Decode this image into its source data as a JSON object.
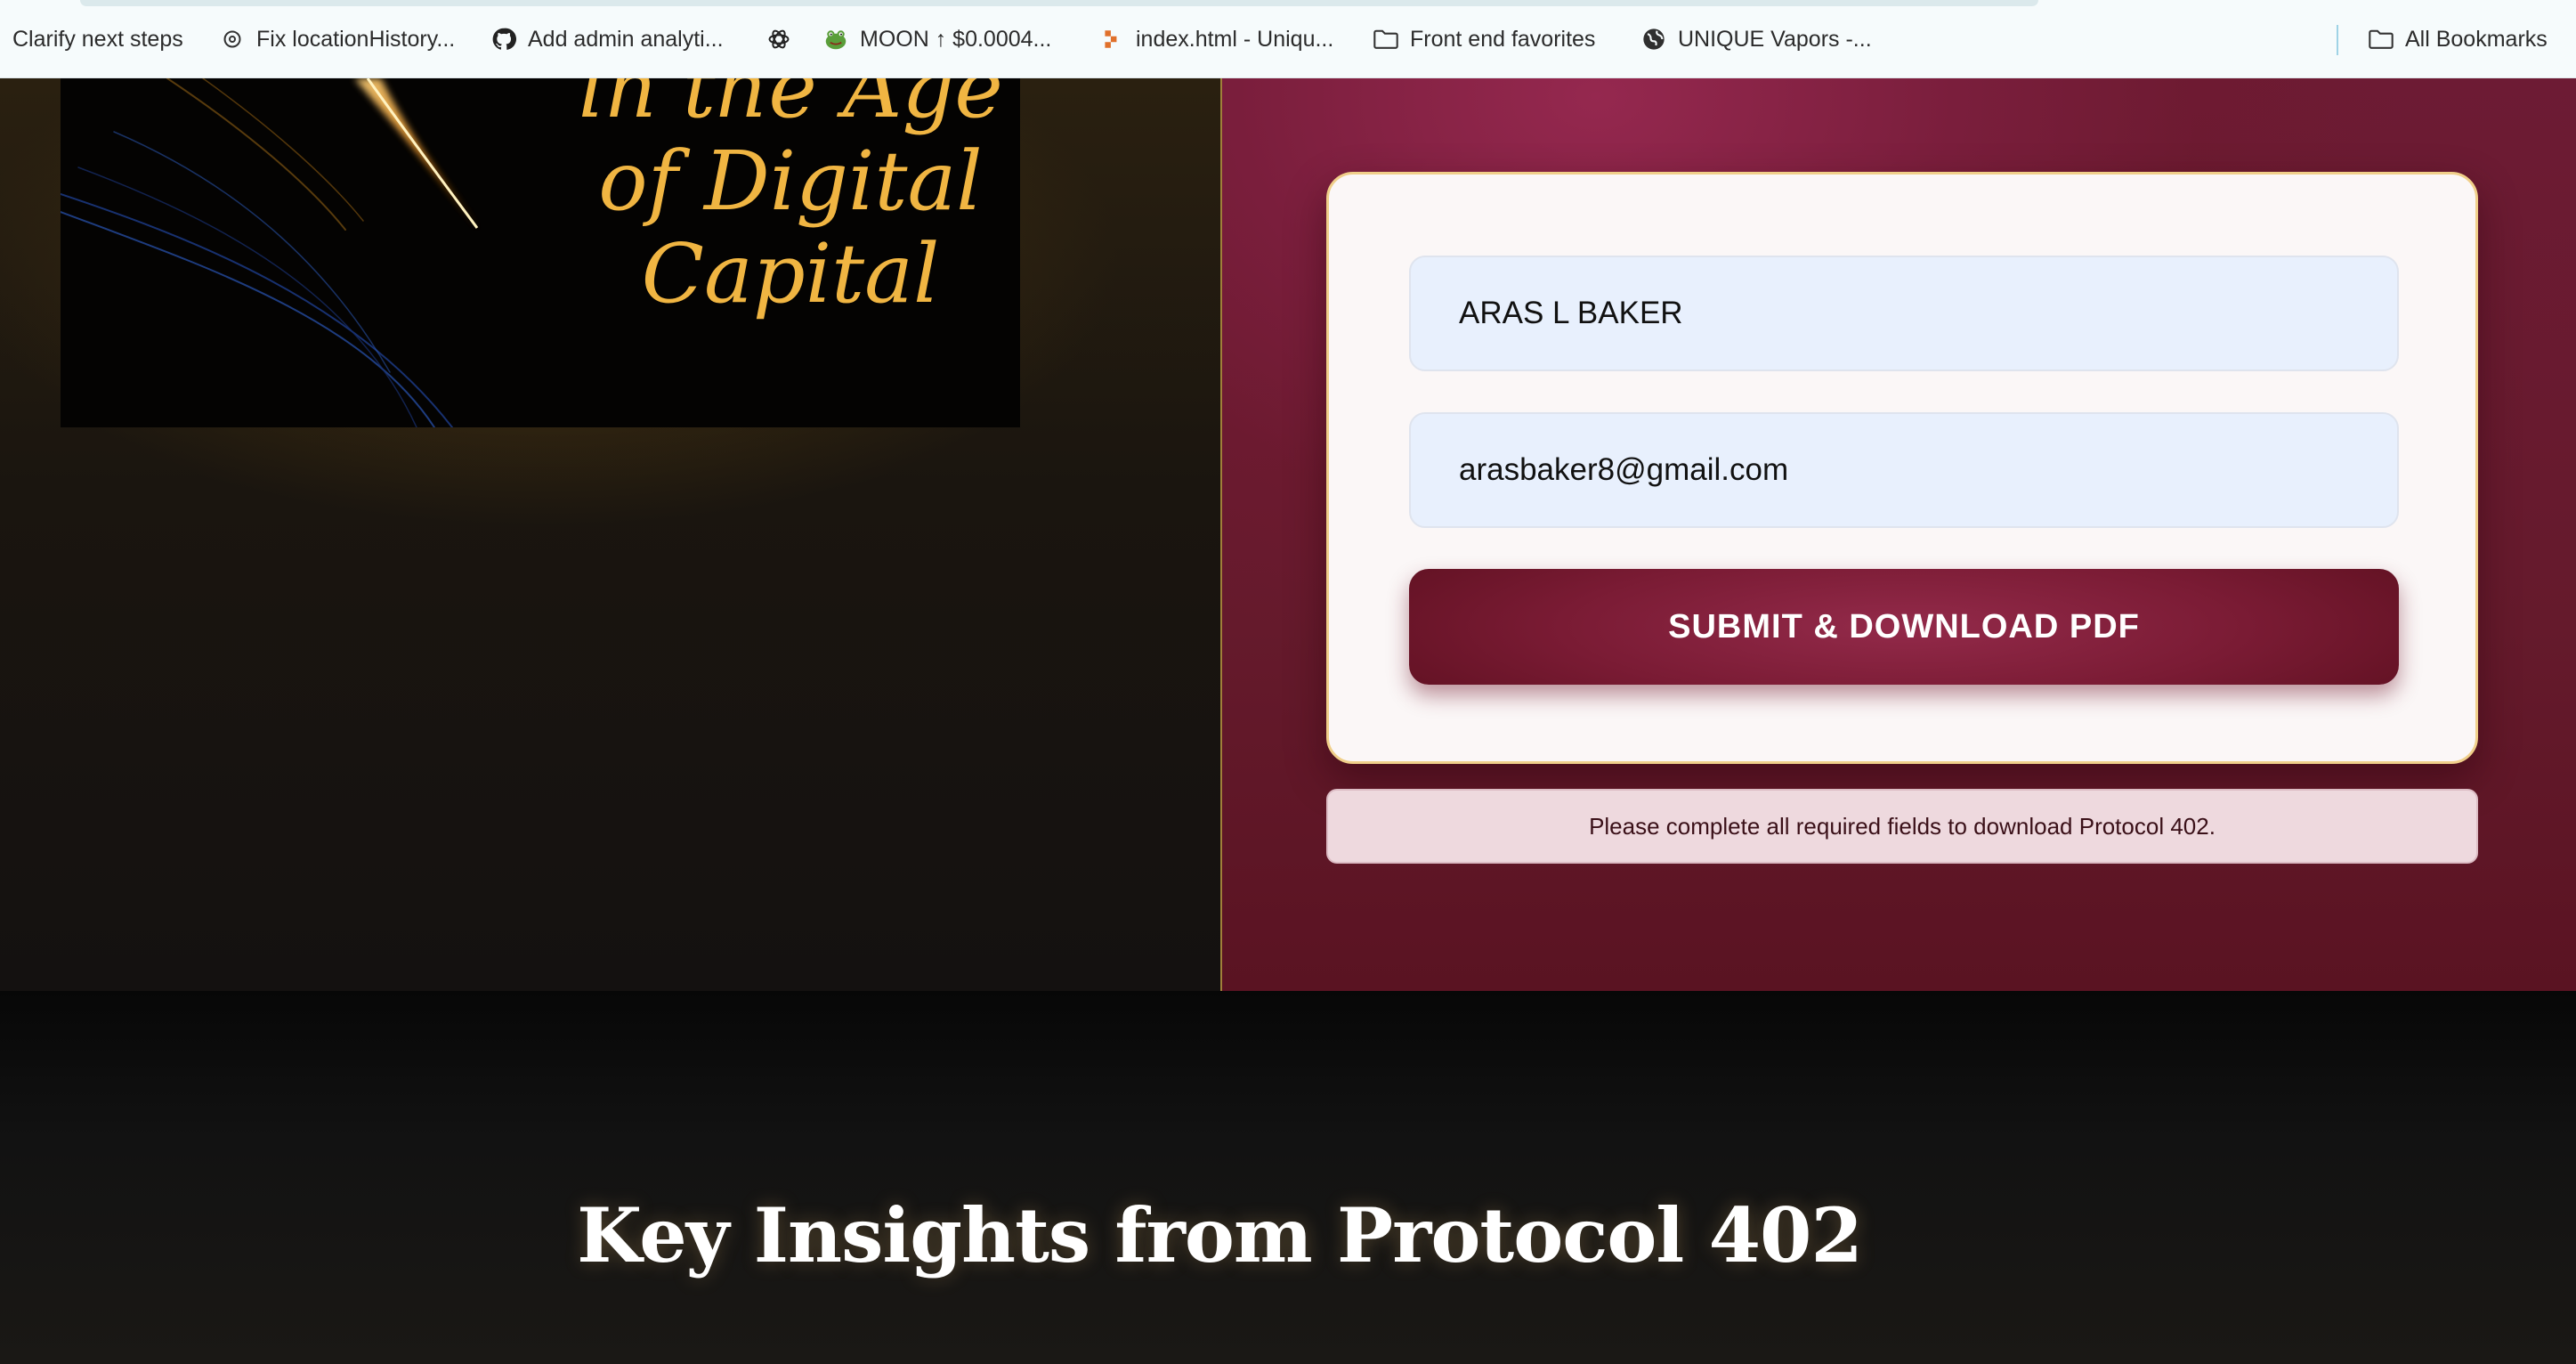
{
  "bookmarks": {
    "items": [
      {
        "label": "Clarify next steps",
        "icon": "none"
      },
      {
        "label": "Fix locationHistory...",
        "icon": "openai-icon"
      },
      {
        "label": "Add admin analyti...",
        "icon": "github-icon"
      },
      {
        "label": "",
        "icon": "chatgpt-icon"
      },
      {
        "label": "MOON ↑ $0.0004...",
        "icon": "frog-icon"
      },
      {
        "label": "index.html - Uniqu...",
        "icon": "figma-like-icon"
      },
      {
        "label": "Front end favorites",
        "icon": "folder-icon"
      },
      {
        "label": "UNIQUE Vapors -...",
        "icon": "globe-icon"
      }
    ],
    "all_bookmarks": {
      "label": "All Bookmarks",
      "icon": "folder-icon"
    }
  },
  "hero": {
    "book_cover": {
      "title_lines": [
        "in the Age",
        "of Digital",
        "Capital"
      ],
      "title_color": "#f0b542"
    },
    "form": {
      "name_value": "ARAS L BAKER",
      "email_value": "arasbaker8@gmail.com",
      "submit_label": "SUBMIT & DOWNLOAD PDF"
    },
    "notice": "Please complete all required fields to download Protocol 402.",
    "colors": {
      "accent_gold": "#f0cf8a",
      "burgundy": "#7a1e3c",
      "input_bg": "#e8f0fd"
    }
  },
  "insights": {
    "title": "Key Insights from Protocol 402"
  }
}
